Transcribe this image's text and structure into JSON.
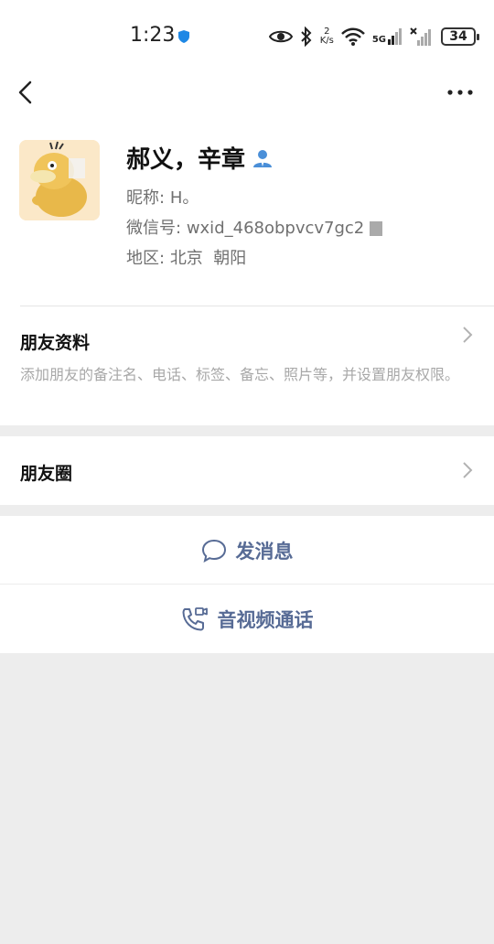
{
  "status": {
    "time": "1:23",
    "speed_value": "2",
    "speed_unit": "K/s",
    "network": "5G",
    "battery": "34"
  },
  "topbar": {
    "back_icon": "chevron-left-icon",
    "more_icon": "more-dots-icon"
  },
  "profile": {
    "name": "郝义，辛章",
    "nickname_label": "昵称:",
    "nickname": "H。",
    "wechat_id_label": "微信号:",
    "wechat_id": "wxid_468obpvcv7gc2",
    "region_label": "地区:",
    "region": "北京  朝阳"
  },
  "friend_info": {
    "title": "朋友资料",
    "description": "添加朋友的备注名、电话、标签、备忘、照片等，并设置朋友权限。"
  },
  "moments": {
    "title": "朋友圈"
  },
  "actions": {
    "message": "发消息",
    "call": "音视频通话"
  },
  "colors": {
    "link": "#576b95",
    "background": "#ededed",
    "secondary_text": "#707070"
  }
}
